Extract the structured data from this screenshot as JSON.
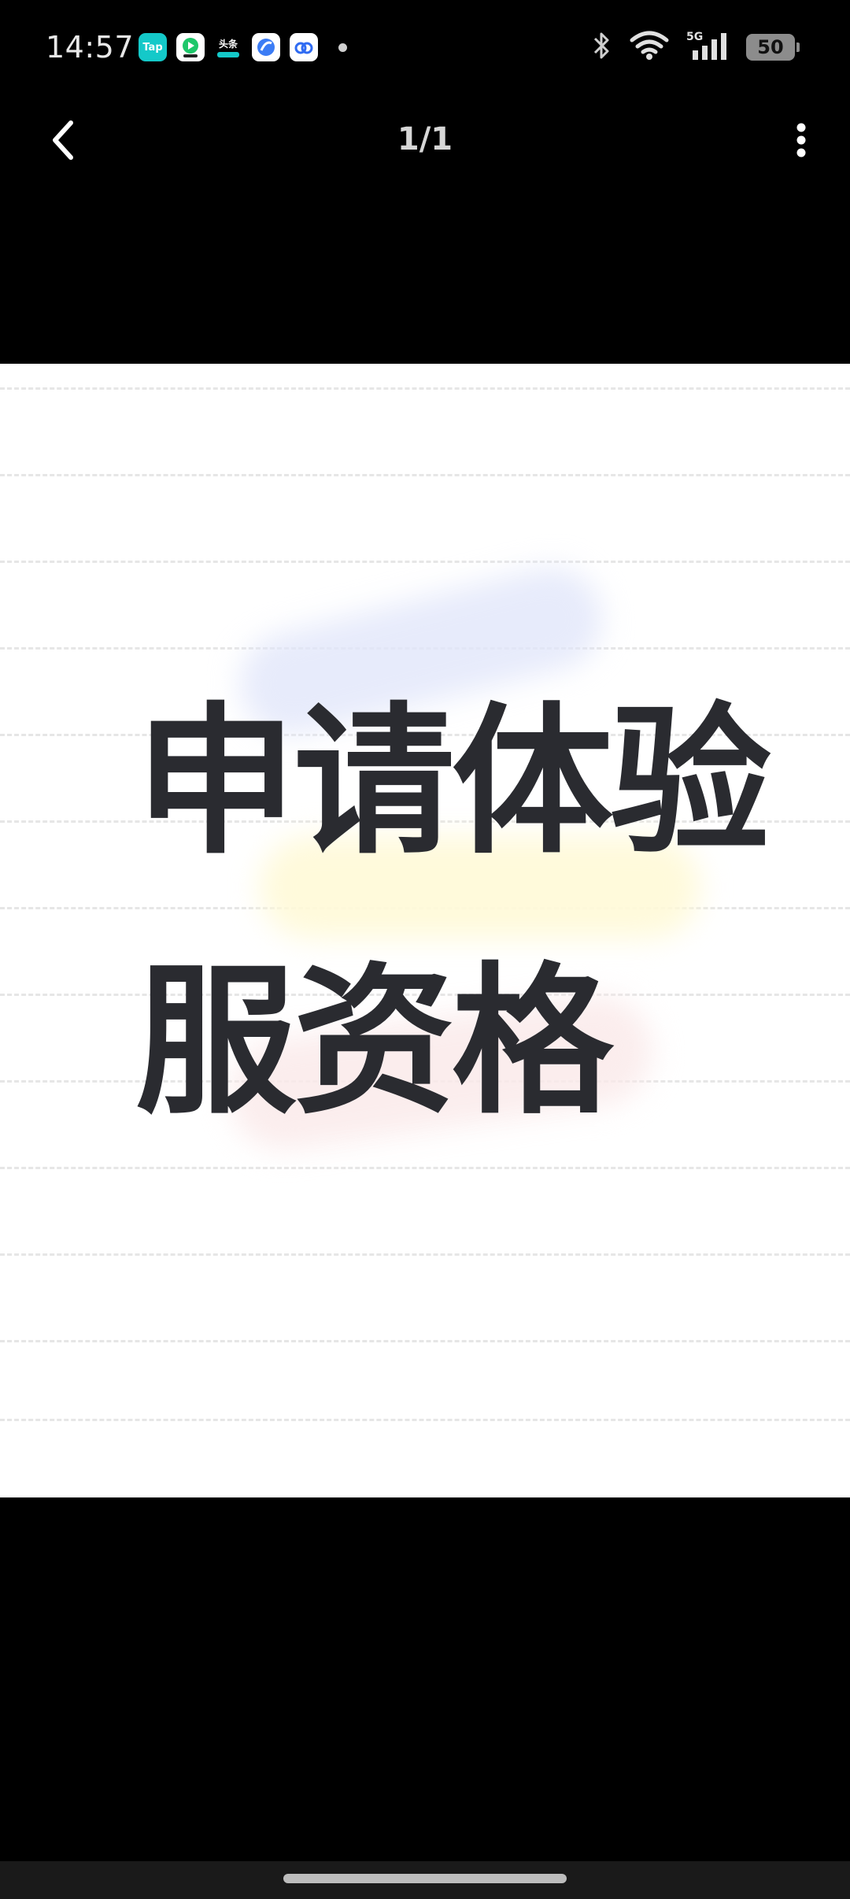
{
  "status_bar": {
    "time": "14:57",
    "notification_icons": [
      "tap-app-icon",
      "video-app-icon",
      "news-app-icon",
      "browser-app-icon",
      "cloud-app-icon"
    ],
    "tap_label": "Tap",
    "news_label": "头条",
    "network": "5G",
    "battery": "50"
  },
  "nav": {
    "page_counter": "1/1",
    "back_icon": "chevron-left-icon",
    "more_icon": "more-vertical-icon"
  },
  "image": {
    "line_1": "申请体验",
    "line_2": "服资格"
  },
  "colors": {
    "background": "#000000",
    "image_background": "#ffffff",
    "headline_text": "#2a2b30"
  }
}
